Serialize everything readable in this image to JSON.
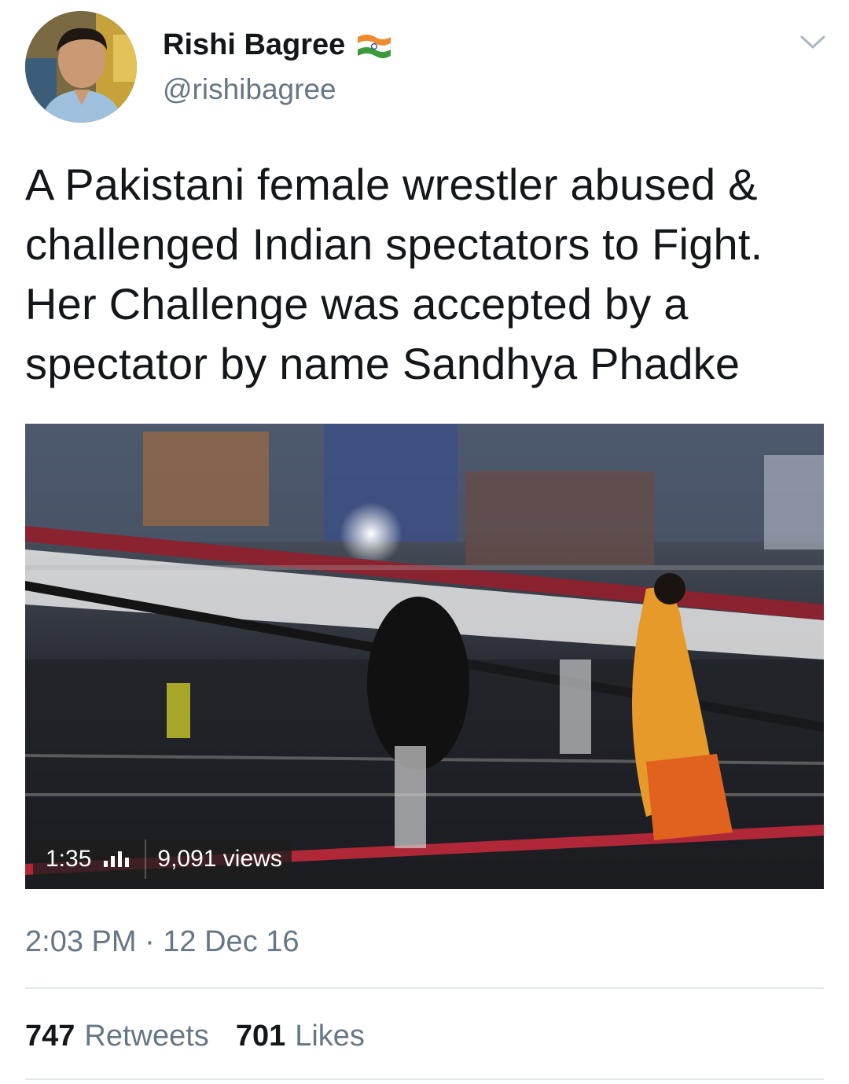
{
  "author": {
    "display_name": "Rishi Bagree",
    "handle": "@rishibagree",
    "badge_icon": "india-flag-icon"
  },
  "menu_icon": "chevron-down-icon",
  "tweet": {
    "text": "A Pakistani female wrestler abused &\nchallenged Indian spectators to Fight.\nHer Challenge was accepted by a\nspectator by name Sandhya Phadke"
  },
  "video": {
    "duration": "1:35",
    "stats_icon": "signal-bars-icon",
    "views": "9,091 views"
  },
  "timestamp": "2:03 PM · 12 Dec 16",
  "stats": {
    "retweets_count": "747",
    "retweets_label": "Retweets",
    "likes_count": "701",
    "likes_label": "Likes"
  },
  "colors": {
    "text_primary": "#14171a",
    "text_secondary": "#657786",
    "divider": "#e1e8ed"
  }
}
